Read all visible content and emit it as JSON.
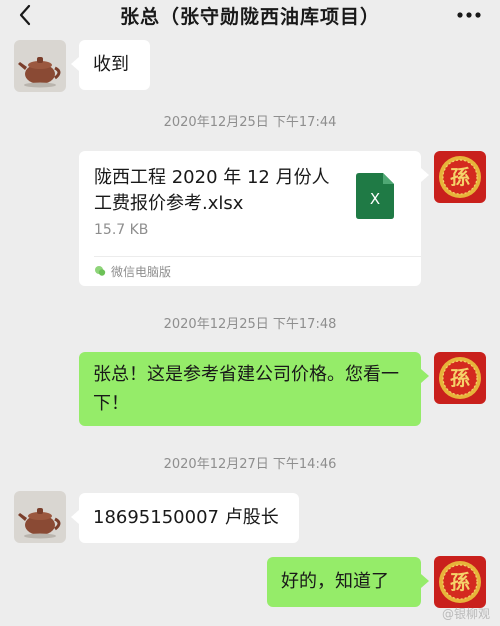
{
  "header": {
    "title": "张总（张守勋陇西油库项目）",
    "back_icon": "chevron-left-icon",
    "more_icon": "more-dots-icon"
  },
  "messages": {
    "m1": {
      "text": "收到"
    },
    "ts1": "2020年12月25日 下午17:44",
    "file": {
      "name": "陇西工程 2020 年 12 月份人工费报价参考.xlsx",
      "size": "15.7 KB",
      "source": "微信电脑版",
      "icon_letter": "X"
    },
    "ts2": "2020年12月25日 下午17:48",
    "m2": {
      "text": "张总！这是参考省建公司价格。您看一下！"
    },
    "ts3": "2020年12月27日 下午14:46",
    "m3": {
      "text": "18695150007 卢股长"
    },
    "m4": {
      "text": "好的，知道了"
    }
  },
  "avatars": {
    "right_char": "孫"
  },
  "watermark": "@银柳观",
  "colors": {
    "background": "#ededed",
    "self_bubble": "#95ec69",
    "other_bubble": "#ffffff",
    "excel_green": "#1f7a45"
  }
}
